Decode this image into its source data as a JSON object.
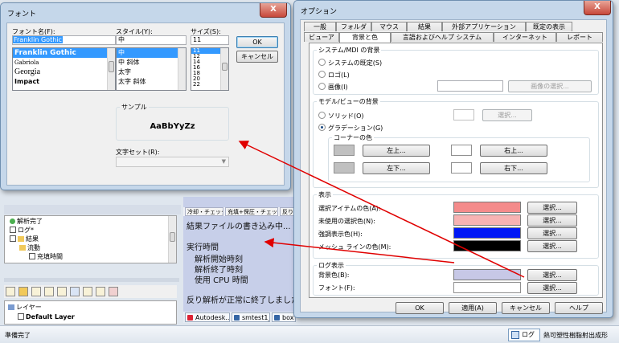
{
  "status_bar": {
    "ready": "準備完了",
    "log_tab": "ログ",
    "material": "熱可塑性樹脂射出成形"
  },
  "tree": {
    "items": [
      "解析完了",
      "ログ*",
      "結果",
      "流動",
      "充填時間"
    ]
  },
  "layer_panel": {
    "header": "レイヤー",
    "layer": "Default Layer"
  },
  "mid_panel": {
    "tabs": [
      "冷却・チェック",
      "充填+保圧・チェック",
      "反り"
    ],
    "line1": "結果ファイルの書き込み中...",
    "exec_header": "実行時間",
    "lines": [
      "解析開始時刻",
      "解析終了時刻",
      "使用 CPU 時間"
    ],
    "last": "反り解析が正常に終了しました"
  },
  "taskbar": [
    "Autodesk...",
    "smtest1_...",
    "box"
  ],
  "font_dialog": {
    "title": "フォント",
    "close": "X",
    "font_name_label": "フォント名(F):",
    "font_name_value": "Franklin Gothic",
    "font_list": [
      "Franklin Gothic",
      "Gabriola",
      "Georgia",
      "Impact"
    ],
    "style_label": "スタイル(Y):",
    "style_value": "中",
    "style_list": [
      "中",
      "中 斜体",
      "太字",
      "太字 斜体"
    ],
    "size_label": "サイズ(S):",
    "size_value": "11",
    "size_list": [
      "11",
      "12",
      "14",
      "16",
      "18",
      "20",
      "22"
    ],
    "ok": "OK",
    "cancel": "キャンセル",
    "sample_label": "サンプル",
    "sample_text": "AaBbYyZz",
    "charset_label": "文字セット(R):"
  },
  "options_dialog": {
    "title": "オプション",
    "close": "X",
    "tabs_row1": [
      "一般",
      "フォルダ",
      "マウス",
      "結果",
      "外部アプリケーション",
      "既定の表示"
    ],
    "tabs_row2": [
      "ビューア",
      "背景と色",
      "言語およびヘルプ システム",
      "インターネット",
      "レポート"
    ],
    "mdi_group": "システム/MDI の背景",
    "mdi_default": "システムの既定(S)",
    "mdi_logo": "ロゴ(L)",
    "mdi_image": "画像(I)",
    "image_select": "画像の選択...",
    "model_group": "モデル/ビューの背景",
    "solid": "ソリッド(O)",
    "gradient": "グラデーション(G)",
    "select": "選択...",
    "corner_group": "コーナーの色",
    "top_left": "左上...",
    "top_right": "右上...",
    "bottom_left": "左下...",
    "bottom_right": "右下...",
    "display_group": "表示",
    "sel_item_color": "選択アイテムの色(A):",
    "unused_sel_color": "未使用の選択色(N):",
    "highlight_color": "強調表示色(H):",
    "mesh_line_color": "メッシュ ラインの色(M):",
    "log_group": "ログ表示",
    "bg_color": "背景色(B):",
    "font": "フォント(F):",
    "ok": "OK",
    "apply": "適用(A)",
    "cancel": "キャンセル",
    "help": "ヘルプ",
    "colors": {
      "selected_item": "#f48b8b",
      "unused_selection": "#f7b3b3",
      "highlight": "#0018f5",
      "mesh_line": "#000000",
      "log_background": "#c7c8e6",
      "corner_fill": "#c0c0c0",
      "arrow": "#e00000"
    }
  }
}
